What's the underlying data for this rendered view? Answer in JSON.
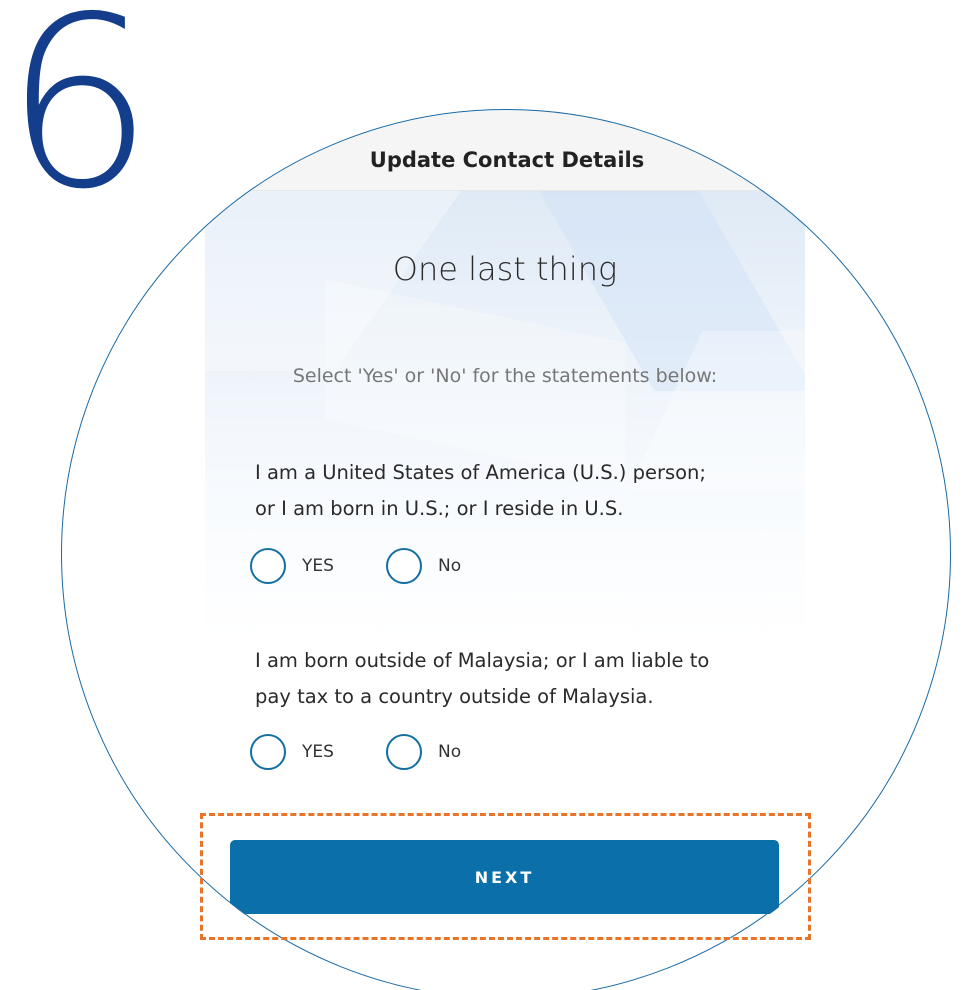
{
  "step": {
    "number": "6"
  },
  "header": {
    "title": "Update Contact Details"
  },
  "main": {
    "heading": "One last thing",
    "instruction": "Select 'Yes' or 'No' for the statements below:",
    "questions": [
      {
        "text_line1": "I am a United States of America (U.S.) person;",
        "text_line2": "or I am born in U.S.; or I reside in U.S.",
        "options": [
          "YES",
          "No"
        ],
        "selected": null
      },
      {
        "text_line1": "I am born outside of Malaysia; or I am liable to",
        "text_line2": "pay tax to a country outside of Malaysia.",
        "options": [
          "YES",
          "No"
        ],
        "selected": null
      }
    ],
    "next_label": "NEXT"
  },
  "colors": {
    "accent": "#0b70a9",
    "step_number": "#143e8c",
    "circle_border": "#1a6aa5",
    "highlight": "#e8742a"
  }
}
